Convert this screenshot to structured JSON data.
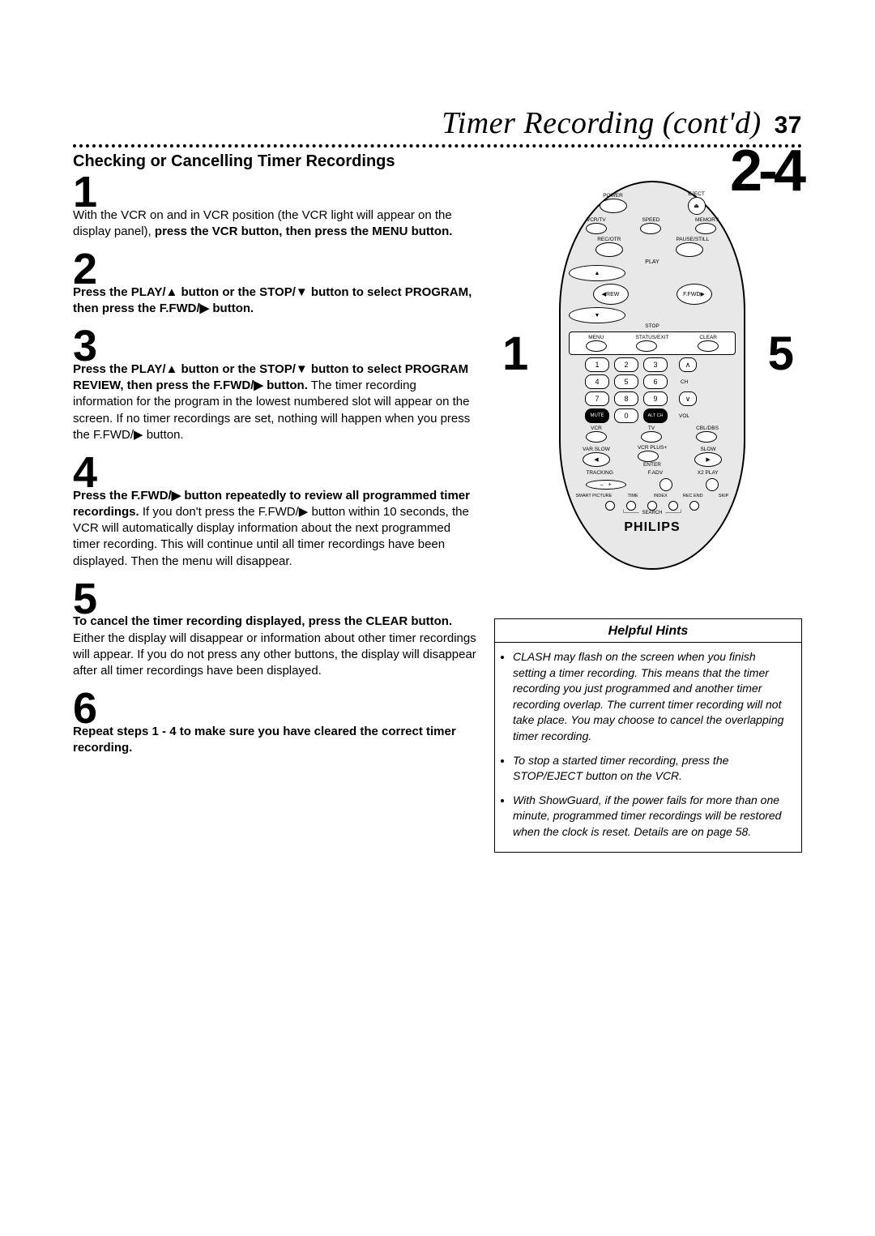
{
  "header": {
    "title": "Timer Recording (cont'd)",
    "page_number": "37",
    "section_range": "2-4",
    "subhead": "Checking or Cancelling Timer Recordings"
  },
  "steps": [
    {
      "num": "1",
      "text_a": "With the VCR on and in VCR position (the VCR light will appear on the display panel), ",
      "text_b": "press the VCR button, then press the MENU button."
    },
    {
      "num": "2",
      "text_a": "",
      "text_b": "Press the PLAY/▲ button or the STOP/▼ button to select PROGRAM, then press the F.FWD/▶ button."
    },
    {
      "num": "3",
      "text_a": "",
      "text_b": "Press the PLAY/▲ button or the STOP/▼ button to select PROGRAM REVIEW, then press the F.FWD/▶ button.",
      "text_c": " The timer recording information for the program in the lowest numbered slot will appear on the screen. If no timer recordings are set, nothing will happen when you press the F.FWD/▶ button."
    },
    {
      "num": "4",
      "text_a": "",
      "text_b": "Press the F.FWD/▶ button repeatedly to review all programmed timer recordings.",
      "text_c": " If you don't press the F.FWD/▶ button within 10 seconds, the VCR will automatically display information about the next programmed timer recording. This will continue until all timer recordings have been displayed. Then the menu will disappear."
    },
    {
      "num": "5",
      "text_a": "",
      "text_b": "To cancel the timer recording displayed, press the CLEAR button.",
      "text_c": " Either the display will disappear or information about other timer recordings will appear. If you do not press any other buttons, the display will disappear after all timer recordings have been displayed."
    },
    {
      "num": "6",
      "text_a": "",
      "text_b": "Repeat steps 1 - 4 to make sure you have cleared the correct timer recording."
    }
  ],
  "callouts": {
    "left": "1",
    "right": "5"
  },
  "remote": {
    "power": "POWER",
    "eject": "EJECT",
    "vcrtv": "VCR/TV",
    "speed": "SPEED",
    "memory": "MEMORY",
    "recotr": "REC/OTR",
    "pausestill": "PAUSE/STILL",
    "play": "PLAY",
    "rew": "REW",
    "ffwd": "F.FWD",
    "stop": "STOP",
    "menu": "MENU",
    "statusexit": "STATUS/EXIT",
    "clear": "CLEAR",
    "ch": "CH",
    "vol": "VOL",
    "mute": "MUTE",
    "altch": "ALT CH",
    "vcr": "VCR",
    "tv": "TV",
    "cbldbs": "CBL/DBS",
    "varslow": "VAR.SLOW",
    "vcrplus": "VCR PLUS+",
    "enter": "ENTER",
    "slow": "SLOW",
    "tracking": "TRACKING",
    "fadv": "F.ADV",
    "x2play": "X2 PLAY",
    "smart": "SMART PICTURE",
    "time": "TIME",
    "index": "INDEX",
    "recend": "REC END",
    "skip": "SKIP",
    "search": "SEARCH",
    "brand": "PHILIPS",
    "n1": "1",
    "n2": "2",
    "n3": "3",
    "n4": "4",
    "n5": "5",
    "n6": "6",
    "n7": "7",
    "n8": "8",
    "n9": "9",
    "n0": "0"
  },
  "hints": {
    "title": "Helpful Hints",
    "items": [
      "CLASH may flash on the screen when you finish setting a timer recording. This means that the timer recording you just programmed and another timer recording overlap. The current timer recording will not take place. You may choose to cancel the overlapping timer recording.",
      "To stop a started timer recording, press the STOP/EJECT button on the VCR.",
      "With ShowGuard, if the power fails for more than one minute, programmed timer recordings will be restored when the clock is reset. Details are on page 58."
    ]
  }
}
